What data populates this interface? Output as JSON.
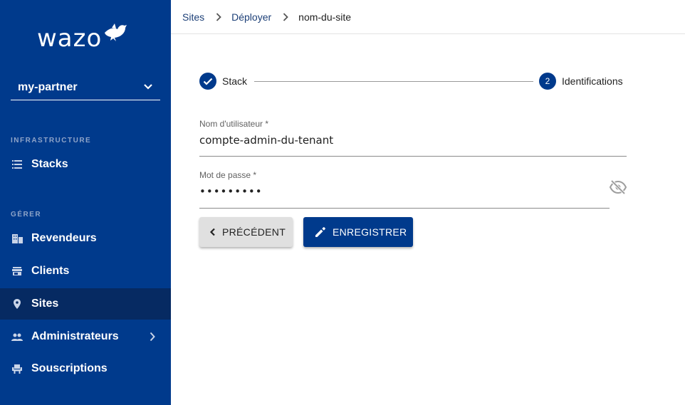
{
  "logo": {
    "text": "wazo",
    "icon": "bird-icon"
  },
  "tenant_selector": {
    "value": "my-partner",
    "icon": "chevron-down-icon"
  },
  "sidebar": {
    "sections": [
      {
        "label": "INFRASTRUCTURE",
        "items": [
          {
            "label": "Stacks",
            "icon": "list-icon"
          }
        ]
      },
      {
        "label": "GÉRER",
        "items": [
          {
            "label": "Revendeurs",
            "icon": "building-icon"
          },
          {
            "label": "Clients",
            "icon": "store-icon"
          },
          {
            "label": "Sites",
            "icon": "location-pin-icon",
            "active": true
          },
          {
            "label": "Administrateurs",
            "icon": "people-icon",
            "has_submenu": true
          },
          {
            "label": "Souscriptions",
            "icon": "seat-icon"
          }
        ]
      }
    ]
  },
  "breadcrumb": [
    "Sites",
    "Déployer",
    "nom-du-site"
  ],
  "stepper": {
    "steps": [
      {
        "label": "Stack",
        "status": "completed",
        "icon": "check-icon"
      },
      {
        "number": "2",
        "label": "Identifications",
        "status": "active"
      }
    ]
  },
  "form": {
    "username": {
      "label": "Nom d'utilisateur *",
      "value": "compte-admin-du-tenant"
    },
    "password": {
      "label": "Mot de passe *",
      "value": "•••••••••",
      "toggle_icon": "eye-off-icon"
    }
  },
  "buttons": {
    "previous": {
      "label": "PRÉCÉDENT",
      "icon": "chevron-left-icon"
    },
    "save": {
      "label": "ENREGISTRER",
      "icon": "pencil-icon"
    }
  },
  "colors": {
    "primary": "#003a8c",
    "sidebar_active": "#062a62",
    "secondary_button": "#e0e0e0"
  }
}
